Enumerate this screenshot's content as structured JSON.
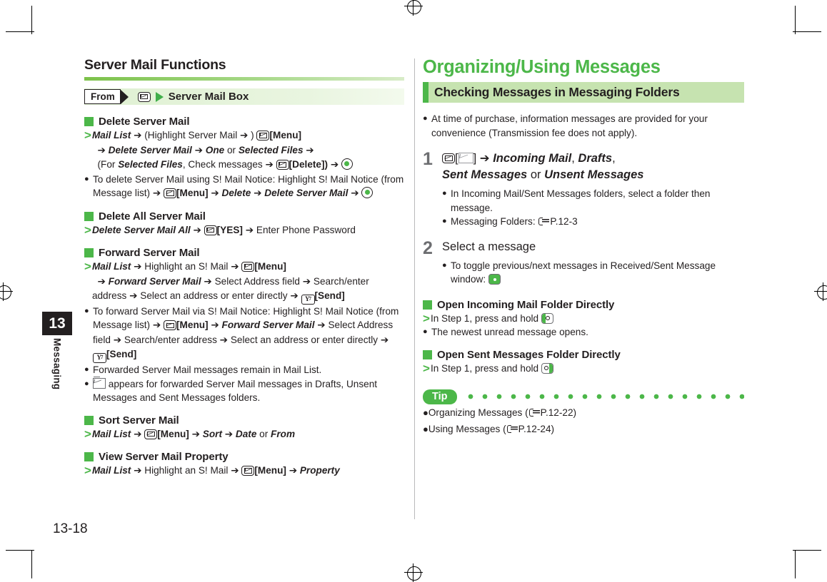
{
  "page": {
    "number": "13-18",
    "chapter_tab": "13",
    "chapter_name": "Messaging"
  },
  "left_column": {
    "section_title": "Server Mail Functions",
    "from_bar": {
      "from_label": "From",
      "icon": "envelope-key-icon",
      "arrow": "green-triangle-icon",
      "path": "Server Mail Box"
    },
    "blocks": [
      {
        "heading": "Delete Server Mail",
        "op_line_1_a": "Mail List",
        "op_line_1_b": "(Highlight Server Mail",
        "op_line_1_c": ")",
        "op_line_1_d": "[Menu]",
        "op_line_2_a": "Delete Server Mail",
        "op_line_2_b": "One",
        "op_line_2_c": "or",
        "op_line_2_d": "Selected Files",
        "op_line_3_a": "(For",
        "op_line_3_b": "Selected Files",
        "op_line_3_c": ", Check messages",
        "op_line_3_d": "[Delete])",
        "bullet_1_a": "To delete Server Mail using S! Mail Notice: Highlight S! Mail Notice (from Message list)",
        "bullet_1_b": "[Menu]",
        "bullet_1_c": "Delete",
        "bullet_1_d": "Delete Server Mail"
      },
      {
        "heading": "Delete All Server Mail",
        "op_a": "Delete Server Mail All",
        "op_b": "[YES]",
        "op_c": "Enter Phone Password"
      },
      {
        "heading": "Forward Server Mail",
        "op_1_a": "Mail List",
        "op_1_b": "Highlight an S! Mail",
        "op_1_c": "[Menu]",
        "op_2_a": "Forward Server Mail",
        "op_2_b": "Select Address field",
        "op_2_c": "Search/enter address",
        "op_2_d": "Select an address or enter directly",
        "op_2_e": "[Send]",
        "bullet_1_a": "To forward Server Mail via S! Mail Notice: Highlight S! Mail Notice (from Message list)",
        "bullet_1_b": "[Menu]",
        "bullet_1_c": "Forward Server Mail",
        "bullet_1_d": "Select Address field",
        "bullet_1_e": "Search/enter address",
        "bullet_1_f": "Select an address or enter directly",
        "bullet_1_g": "[Send]",
        "bullet_2": "Forwarded Server Mail messages remain in Mail List.",
        "bullet_3": "appears for forwarded Server Mail messages in Drafts, Unsent Messages and Sent Messages folders."
      },
      {
        "heading": "Sort Server Mail",
        "op_a": "Mail List",
        "op_b": "[Menu]",
        "op_c": "Sort",
        "op_d": "Date",
        "op_e": "or",
        "op_f": "From"
      },
      {
        "heading": "View Server Mail Property",
        "op_a": "Mail List",
        "op_b": "Highlight an S! Mail",
        "op_c": "[Menu]",
        "op_d": "Property"
      }
    ]
  },
  "right_column": {
    "big_title": "Organizing/Using Messages",
    "band_title": "Checking Messages in Messaging Folders",
    "intro_bullet": "At time of purchase, information messages are provided for your convenience (Transmission fee does not apply).",
    "steps": [
      {
        "num": "1",
        "text_a": "[",
        "text_b": "]",
        "text_c": "Incoming Mail",
        "text_d": ",",
        "text_e": "Drafts",
        "text_f": ",",
        "text_g": "Sent Messages",
        "text_h": "or",
        "text_i": "Unsent Messages",
        "bullets": [
          "In Incoming Mail/Sent Messages folders, select a folder then message.",
          "Messaging Folders:"
        ],
        "bullet_2_ref": "P.12-3"
      },
      {
        "num": "2",
        "text": "Select a message",
        "bullets": [
          "To toggle previous/next messages in Received/Sent Message window:"
        ]
      }
    ],
    "blocks": [
      {
        "heading": "Open Incoming Mail Folder Directly",
        "op": "In Step 1, press and hold",
        "bullet": "The newest unread message opens."
      },
      {
        "heading": "Open Sent Messages Folder Directly",
        "op": "In Step 1, press and hold"
      }
    ],
    "tip": {
      "badge": "Tip",
      "items": [
        {
          "text": "Organizing Messages (",
          "ref": "P.12-22",
          "close": ")"
        },
        {
          "text": "Using Messages (",
          "ref": "P.12-24",
          "close": ")"
        }
      ]
    }
  },
  "colors": {
    "accent_green": "#4cb749",
    "band_green": "#c6e3b0",
    "from_bar_green": "#dff0d2",
    "text": "#231f20",
    "step_num_gray": "#6d6e71"
  }
}
